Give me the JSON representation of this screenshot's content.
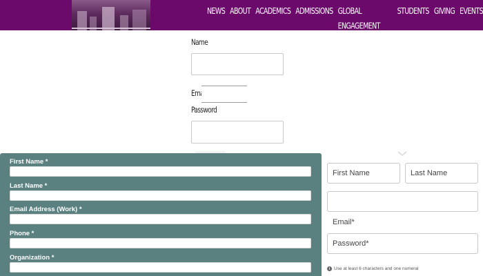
{
  "header": {
    "nav": [
      "NEWS",
      "ABOUT",
      "ACADEMICS",
      "ADMISSIONS",
      "GLOBAL ENGAGEMENT",
      "STUDENTS",
      "GIVING",
      "EVENTS"
    ],
    "bar_color": "#6b0a6b"
  },
  "simple_form": {
    "name_label": "Name",
    "email_label": "Email",
    "password_label": "Password"
  },
  "teal_form": {
    "color": "#5b8080",
    "first_name": "First Name *",
    "last_name": "Last Name *",
    "email": "Email Address (Work) *",
    "phone": "Phone *",
    "organization": "Organization *"
  },
  "right_form": {
    "first_name_placeholder": "First Name",
    "last_name_placeholder": "Last Name",
    "email_label": "Email*",
    "password_placeholder": "Password*",
    "hint": "Use at least 6 characters and one numeral",
    "info_icon": "info-icon"
  }
}
